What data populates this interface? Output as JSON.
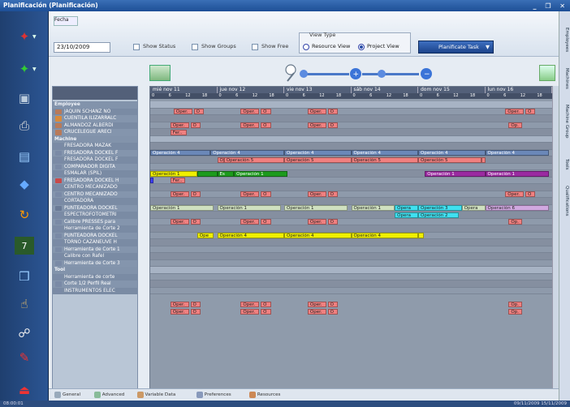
{
  "window": {
    "title": "Planificación (Planificación)",
    "controls": "_ ❐ ✕"
  },
  "toolbar": {
    "fecha_button": "Fecha",
    "date_value": "23/10/2009",
    "show_status": "Show Status",
    "show_groups": "Show Groups",
    "show_free": "Show Free",
    "view_type_title": "View Type",
    "resource_view": "Resource View",
    "project_view": "Project View",
    "planificate_task": "Planificate Task"
  },
  "left_panel": {
    "groups": [
      {
        "label": "Employee",
        "items": [
          {
            "name": "JAQUIN SCHANZ NO",
            "color": "#b87a5a"
          },
          {
            "name": "CUENTILA ILIZARRALC",
            "color": "#d98a3b"
          },
          {
            "name": "ALMANDOZ ALBERDI",
            "color": "#b87a5a"
          },
          {
            "name": "CRUCELEGUE ARECI",
            "color": "#b87a5a"
          }
        ]
      },
      {
        "label": "Machine",
        "items": [
          {
            "name": "FRESADORA MAZAK",
            "color": "#7a8aa6"
          },
          {
            "name": "FRESADORA DOCKEL F",
            "color": "#7a8aa6"
          },
          {
            "name": "FRESADORA DOCKEL F",
            "color": "#7a8aa6"
          },
          {
            "name": "COMPARADOR DIGITA",
            "color": "#7a8aa6"
          },
          {
            "name": "ESMALAR (SPIL)",
            "color": "#7a8aa6"
          },
          {
            "name": "FRESADORA DOCKEL H",
            "color": "#c84a4a"
          },
          {
            "name": "CENTRO MECANIZADO",
            "color": "#7a8aa6"
          },
          {
            "name": "CENTRO MECANIZADO",
            "color": "#7a8aa6"
          },
          {
            "name": "CORTADORA",
            "color": "#7a8aa6"
          },
          {
            "name": "PUNTEADORA DOCKEL",
            "color": "#6a7a96"
          },
          {
            "name": "ESPECTROFOTOMETRI",
            "color": "#7a8aa6"
          },
          {
            "name": "Calibre PRESSES para",
            "color": "#7a8aa6"
          },
          {
            "name": "Herramienta de Corte 2",
            "color": "#7a8aa6"
          },
          {
            "name": "PUNTEADORA DOCKEL",
            "color": "#7a8aa6"
          },
          {
            "name": "TORNO CAZANEUVE H",
            "color": "#7a8aa6"
          },
          {
            "name": "Herramienta de Corte 1",
            "color": "#7a8aa6"
          },
          {
            "name": "Calibre con Rafel",
            "color": "#7a8aa6"
          },
          {
            "name": "Herramienta de Corte 3",
            "color": "#7a8aa6"
          }
        ]
      },
      {
        "label": "Tool",
        "items": [
          {
            "name": "Herramienta de corte",
            "color": "#7a8aa6"
          },
          {
            "name": "Corte 1/2 Perfil Real",
            "color": "#7a8aa6"
          },
          {
            "name": "INSTRUMENTOS ELEC",
            "color": "#7a8aa6"
          }
        ]
      }
    ]
  },
  "timeline": {
    "days": [
      "mié nov 11",
      "jue nov 12",
      "vie nov 13",
      "sáb nov 14",
      "dom nov 15",
      "lun nov 16"
    ],
    "hours": [
      "0",
      "6",
      "12",
      "18"
    ]
  },
  "bars": [
    {
      "row": 1,
      "day": 0,
      "start": 0.35,
      "len": 0.28,
      "label": "Oper.",
      "color": "#f08080"
    },
    {
      "row": 1,
      "day": 0,
      "start": 0.65,
      "len": 0.15,
      "label": "O",
      "color": "#f08080"
    },
    {
      "row": 1,
      "day": 1,
      "start": 0.35,
      "len": 0.28,
      "label": "Oper.",
      "color": "#f08080"
    },
    {
      "row": 1,
      "day": 1,
      "start": 0.65,
      "len": 0.15,
      "label": "O",
      "color": "#f08080"
    },
    {
      "row": 1,
      "day": 2,
      "start": 0.35,
      "len": 0.28,
      "label": "Oper.",
      "color": "#f08080"
    },
    {
      "row": 1,
      "day": 2,
      "start": 0.65,
      "len": 0.15,
      "label": "O",
      "color": "#f08080"
    },
    {
      "row": 1,
      "day": 5,
      "start": 0.3,
      "len": 0.28,
      "label": "Oper.",
      "color": "#f08080"
    },
    {
      "row": 1,
      "day": 5,
      "start": 0.6,
      "len": 0.15,
      "label": "O",
      "color": "#f08080"
    },
    {
      "row": 3,
      "day": 0,
      "start": 0.3,
      "len": 0.28,
      "label": "Oper.",
      "color": "#f08080"
    },
    {
      "row": 3,
      "day": 0,
      "start": 0.6,
      "len": 0.15,
      "label": "O",
      "color": "#f08080"
    },
    {
      "row": 3,
      "day": 1,
      "start": 0.35,
      "len": 0.28,
      "label": "Oper.",
      "color": "#f08080"
    },
    {
      "row": 3,
      "day": 1,
      "start": 0.65,
      "len": 0.15,
      "label": "O",
      "color": "#f08080"
    },
    {
      "row": 3,
      "day": 2,
      "start": 0.35,
      "len": 0.28,
      "label": "Oper.",
      "color": "#f08080"
    },
    {
      "row": 3,
      "day": 2,
      "start": 0.65,
      "len": 0.15,
      "label": "O",
      "color": "#f08080"
    },
    {
      "row": 3,
      "day": 5,
      "start": 0.35,
      "len": 0.2,
      "label": "Op.",
      "color": "#f08080"
    },
    {
      "row": 4,
      "day": 0,
      "start": 0.3,
      "len": 0.25,
      "label": "Fer..",
      "color": "#f08080"
    },
    {
      "row": 7,
      "day": 0,
      "start": 0.0,
      "len": 0.9,
      "label": "Operación 4",
      "color": "#6b88b8"
    },
    {
      "row": 7,
      "day": 0,
      "start": 0.9,
      "len": 1.1,
      "label": "Operación 4",
      "color": "#6b88b8"
    },
    {
      "row": 7,
      "day": 2,
      "start": 0.0,
      "len": 1.0,
      "label": "Operación 4",
      "color": "#6b88b8"
    },
    {
      "row": 7,
      "day": 3,
      "start": 0.0,
      "len": 1.0,
      "label": "Operación 4",
      "color": "#6b88b8"
    },
    {
      "row": 7,
      "day": 4,
      "start": 0.0,
      "len": 1.0,
      "label": "Operación 4",
      "color": "#6b88b8"
    },
    {
      "row": 7,
      "day": 5,
      "start": 0.0,
      "len": 0.95,
      "label": "Operación 4",
      "color": "#6b88b8"
    },
    {
      "row": 8,
      "day": 1,
      "start": 0.0,
      "len": 0.1,
      "label": "O",
      "color": "#f08080"
    },
    {
      "row": 8,
      "day": 1,
      "start": 0.1,
      "len": 0.9,
      "label": "Operación 5",
      "color": "#f08080"
    },
    {
      "row": 8,
      "day": 2,
      "start": 0.0,
      "len": 1.0,
      "label": "Operación 5",
      "color": "#f08080"
    },
    {
      "row": 8,
      "day": 3,
      "start": 0.0,
      "len": 1.0,
      "label": "Operación 5",
      "color": "#f08080"
    },
    {
      "row": 8,
      "day": 4,
      "start": 0.0,
      "len": 0.95,
      "label": "Operación 5",
      "color": "#f08080"
    },
    {
      "row": 8,
      "day": 4,
      "start": 0.95,
      "len": 0.05,
      "label": "",
      "color": "#f08080"
    },
    {
      "row": 10,
      "day": 0,
      "start": 0.0,
      "len": 0.7,
      "label": "Operación 1",
      "color": "#f0f000"
    },
    {
      "row": 10,
      "day": 0,
      "start": 0.7,
      "len": 0.3,
      "label": "",
      "color": "#1c9a1c"
    },
    {
      "row": 10,
      "day": 1,
      "start": 0.0,
      "len": 0.25,
      "label": "Es",
      "color": "#1c9a1c"
    },
    {
      "row": 10,
      "day": 1,
      "start": 0.25,
      "len": 0.8,
      "label": "Operación 1",
      "color": "#1c9a1c"
    },
    {
      "row": 10,
      "day": 4,
      "start": 0.1,
      "len": 0.9,
      "label": "Operación 1",
      "color": "#9a2aa0"
    },
    {
      "row": 10,
      "day": 5,
      "start": 0.0,
      "len": 0.95,
      "label": "Operación 1",
      "color": "#9a2aa0"
    },
    {
      "row": 11,
      "day": 0,
      "start": 0.0,
      "len": 0.05,
      "label": "",
      "color": "#4040ff"
    },
    {
      "row": 11,
      "day": 0,
      "start": 0.3,
      "len": 0.22,
      "label": "Fer..",
      "color": "#f08080"
    },
    {
      "row": 13,
      "day": 0,
      "start": 0.3,
      "len": 0.28,
      "label": "Oper.",
      "color": "#f08080"
    },
    {
      "row": 13,
      "day": 0,
      "start": 0.6,
      "len": 0.15,
      "label": "O",
      "color": "#f08080"
    },
    {
      "row": 13,
      "day": 1,
      "start": 0.35,
      "len": 0.28,
      "label": "Oper.",
      "color": "#f08080"
    },
    {
      "row": 13,
      "day": 1,
      "start": 0.65,
      "len": 0.15,
      "label": "O",
      "color": "#f08080"
    },
    {
      "row": 13,
      "day": 2,
      "start": 0.35,
      "len": 0.28,
      "label": "Oper.",
      "color": "#f08080"
    },
    {
      "row": 13,
      "day": 2,
      "start": 0.65,
      "len": 0.15,
      "label": "O",
      "color": "#f08080"
    },
    {
      "row": 13,
      "day": 5,
      "start": 0.3,
      "len": 0.28,
      "label": "Oper.",
      "color": "#f08080"
    },
    {
      "row": 13,
      "day": 5,
      "start": 0.6,
      "len": 0.15,
      "label": "O",
      "color": "#f08080"
    },
    {
      "row": 15,
      "day": 0,
      "start": 0.0,
      "len": 0.95,
      "label": "Operación 1",
      "color": "#cfe0c0"
    },
    {
      "row": 15,
      "day": 1,
      "start": 0.0,
      "len": 0.95,
      "label": "Operación 1",
      "color": "#cfe0c0"
    },
    {
      "row": 15,
      "day": 2,
      "start": 0.0,
      "len": 0.95,
      "label": "Operación 1",
      "color": "#cfe0c0"
    },
    {
      "row": 15,
      "day": 3,
      "start": 0.0,
      "len": 0.65,
      "label": "Operación 1",
      "color": "#cfe0c0"
    },
    {
      "row": 15,
      "day": 3,
      "start": 0.65,
      "len": 0.35,
      "label": "Opera",
      "color": "#40e0f0"
    },
    {
      "row": 15,
      "day": 4,
      "start": 0.0,
      "len": 0.65,
      "label": "Operación 3",
      "color": "#40e0f0"
    },
    {
      "row": 15,
      "day": 4,
      "start": 0.65,
      "len": 0.35,
      "label": "Opera",
      "color": "#cfe0c0"
    },
    {
      "row": 15,
      "day": 5,
      "start": 0.0,
      "len": 0.95,
      "label": "Operación 6",
      "color": "#d0a8e0"
    },
    {
      "row": 16,
      "day": 3,
      "start": 0.65,
      "len": 0.35,
      "label": "Opera",
      "color": "#40e0f0"
    },
    {
      "row": 16,
      "day": 4,
      "start": 0.0,
      "len": 0.6,
      "label": "Operación 2",
      "color": "#40e0f0"
    },
    {
      "row": 17,
      "day": 0,
      "start": 0.3,
      "len": 0.28,
      "label": "Oper.",
      "color": "#f08080"
    },
    {
      "row": 17,
      "day": 0,
      "start": 0.6,
      "len": 0.15,
      "label": "O",
      "color": "#f08080"
    },
    {
      "row": 17,
      "day": 1,
      "start": 0.35,
      "len": 0.28,
      "label": "Oper.",
      "color": "#f08080"
    },
    {
      "row": 17,
      "day": 1,
      "start": 0.65,
      "len": 0.15,
      "label": "O",
      "color": "#f08080"
    },
    {
      "row": 17,
      "day": 2,
      "start": 0.35,
      "len": 0.28,
      "label": "Oper.",
      "color": "#f08080"
    },
    {
      "row": 17,
      "day": 2,
      "start": 0.65,
      "len": 0.15,
      "label": "O",
      "color": "#f08080"
    },
    {
      "row": 17,
      "day": 5,
      "start": 0.35,
      "len": 0.2,
      "label": "Op.",
      "color": "#f08080"
    },
    {
      "row": 19,
      "day": 0,
      "start": 0.7,
      "len": 0.25,
      "label": "Ope",
      "color": "#f0f000"
    },
    {
      "row": 19,
      "day": 1,
      "start": 0.0,
      "len": 1.0,
      "label": "Operación 4",
      "color": "#f0f000"
    },
    {
      "row": 19,
      "day": 2,
      "start": 0.0,
      "len": 1.0,
      "label": "Operación 4",
      "color": "#f0f000"
    },
    {
      "row": 19,
      "day": 3,
      "start": 0.0,
      "len": 1.0,
      "label": "Operación 4",
      "color": "#f0f000"
    },
    {
      "row": 19,
      "day": 4,
      "start": 0.0,
      "len": 0.08,
      "label": "",
      "color": "#f0f000"
    },
    {
      "row": 29,
      "day": 0,
      "start": 0.3,
      "len": 0.28,
      "label": "Oper.",
      "color": "#f08080"
    },
    {
      "row": 29,
      "day": 0,
      "start": 0.6,
      "len": 0.15,
      "label": "O",
      "color": "#f08080"
    },
    {
      "row": 29,
      "day": 1,
      "start": 0.35,
      "len": 0.28,
      "label": "Oper.",
      "color": "#f08080"
    },
    {
      "row": 29,
      "day": 1,
      "start": 0.65,
      "len": 0.15,
      "label": "O",
      "color": "#f08080"
    },
    {
      "row": 29,
      "day": 2,
      "start": 0.35,
      "len": 0.28,
      "label": "Oper.",
      "color": "#f08080"
    },
    {
      "row": 29,
      "day": 2,
      "start": 0.65,
      "len": 0.15,
      "label": "O",
      "color": "#f08080"
    },
    {
      "row": 29,
      "day": 5,
      "start": 0.35,
      "len": 0.2,
      "label": "Op.",
      "color": "#f08080"
    },
    {
      "row": 30,
      "day": 0,
      "start": 0.3,
      "len": 0.28,
      "label": "Oper.",
      "color": "#f08080"
    },
    {
      "row": 30,
      "day": 0,
      "start": 0.6,
      "len": 0.15,
      "label": "O",
      "color": "#f08080"
    },
    {
      "row": 30,
      "day": 1,
      "start": 0.35,
      "len": 0.28,
      "label": "Oper.",
      "color": "#f08080"
    },
    {
      "row": 30,
      "day": 1,
      "start": 0.65,
      "len": 0.15,
      "label": "O",
      "color": "#f08080"
    },
    {
      "row": 30,
      "day": 2,
      "start": 0.35,
      "len": 0.28,
      "label": "Oper.",
      "color": "#f08080"
    },
    {
      "row": 30,
      "day": 2,
      "start": 0.65,
      "len": 0.15,
      "label": "O",
      "color": "#f08080"
    },
    {
      "row": 30,
      "day": 5,
      "start": 0.35,
      "len": 0.2,
      "label": "Op.",
      "color": "#f08080"
    }
  ],
  "tabs": [
    {
      "label": "General",
      "color": "#9ab"
    },
    {
      "label": "Advanced",
      "color": "#8b9"
    },
    {
      "label": "Variable Data",
      "color": "#c96"
    },
    {
      "label": "Preferences",
      "color": "#89b"
    },
    {
      "label": "Resources",
      "color": "#c85"
    }
  ],
  "right_tabs": [
    "Employees",
    "Machines",
    "Machine Group",
    "Tools",
    "Qualifications"
  ],
  "status": {
    "left": "08:00:01",
    "right": "09/11/2009  15/11/2009"
  }
}
